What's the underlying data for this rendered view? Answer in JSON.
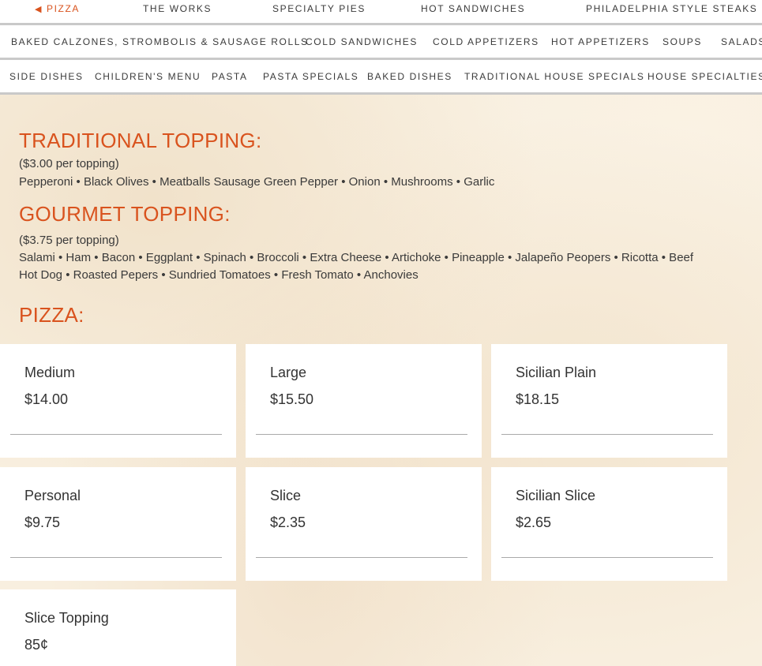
{
  "nav": {
    "row1": [
      {
        "label": "PIZZA",
        "active": true
      },
      {
        "label": "THE WORKS"
      },
      {
        "label": "SPECIALTY PIES"
      },
      {
        "label": "HOT SANDWICHES"
      },
      {
        "label": "PHILADELPHIA STYLE STEAKS"
      }
    ],
    "row2": [
      {
        "label": "BAKED CALZONES, STROMBOLIS & SAUSAGE ROLLS"
      },
      {
        "label": "COLD SANDWICHES"
      },
      {
        "label": "COLD APPETIZERS"
      },
      {
        "label": "HOT APPETIZERS"
      },
      {
        "label": "SOUPS"
      },
      {
        "label": "SALADS"
      }
    ],
    "row3": [
      {
        "label": "SIDE DISHES"
      },
      {
        "label": "CHILDREN'S MENU"
      },
      {
        "label": "PASTA"
      },
      {
        "label": "PASTA SPECIALS"
      },
      {
        "label": "BAKED DISHES"
      },
      {
        "label": "TRADITIONAL HOUSE SPECIALS"
      },
      {
        "label": "HOUSE SPECIALTIES"
      }
    ],
    "prev_arrow": "◀",
    "next_arrow": "▶"
  },
  "traditional": {
    "title": "TRADITIONAL TOPPING:",
    "price_note": "($3.00 per topping)",
    "items": "Pepperoni • Black Olives • Meatballs Sausage Green Pepper • Onion • Mushrooms • Garlic"
  },
  "gourmet": {
    "title": "GOURMET TOPPING:",
    "price_note": "($3.75 per topping)",
    "items_line1": "Salami • Ham • Bacon • Eggplant • Spinach • Broccoli • Extra Cheese • Artichoke • Pineapple • Jalapeño Peopers • Ricotta • Beef",
    "items_line2": "Hot Dog  • Roasted Pepers • Sundried Tomatoes • Fresh Tomato • Anchovies"
  },
  "pizza": {
    "title": "PIZZA:",
    "items": [
      {
        "name": "Medium",
        "price": "$14.00"
      },
      {
        "name": "Large",
        "price": "$15.50"
      },
      {
        "name": "Sicilian Plain",
        "price": "$18.15"
      },
      {
        "name": "Personal",
        "price": "$9.75"
      },
      {
        "name": "Slice",
        "price": "$2.35"
      },
      {
        "name": "Sicilian Slice",
        "price": "$2.65"
      },
      {
        "name": "Slice Topping",
        "price": "85¢"
      }
    ]
  },
  "colors": {
    "accent": "#d9531e",
    "text": "#3a3a3a",
    "background": "#f8efdf"
  }
}
